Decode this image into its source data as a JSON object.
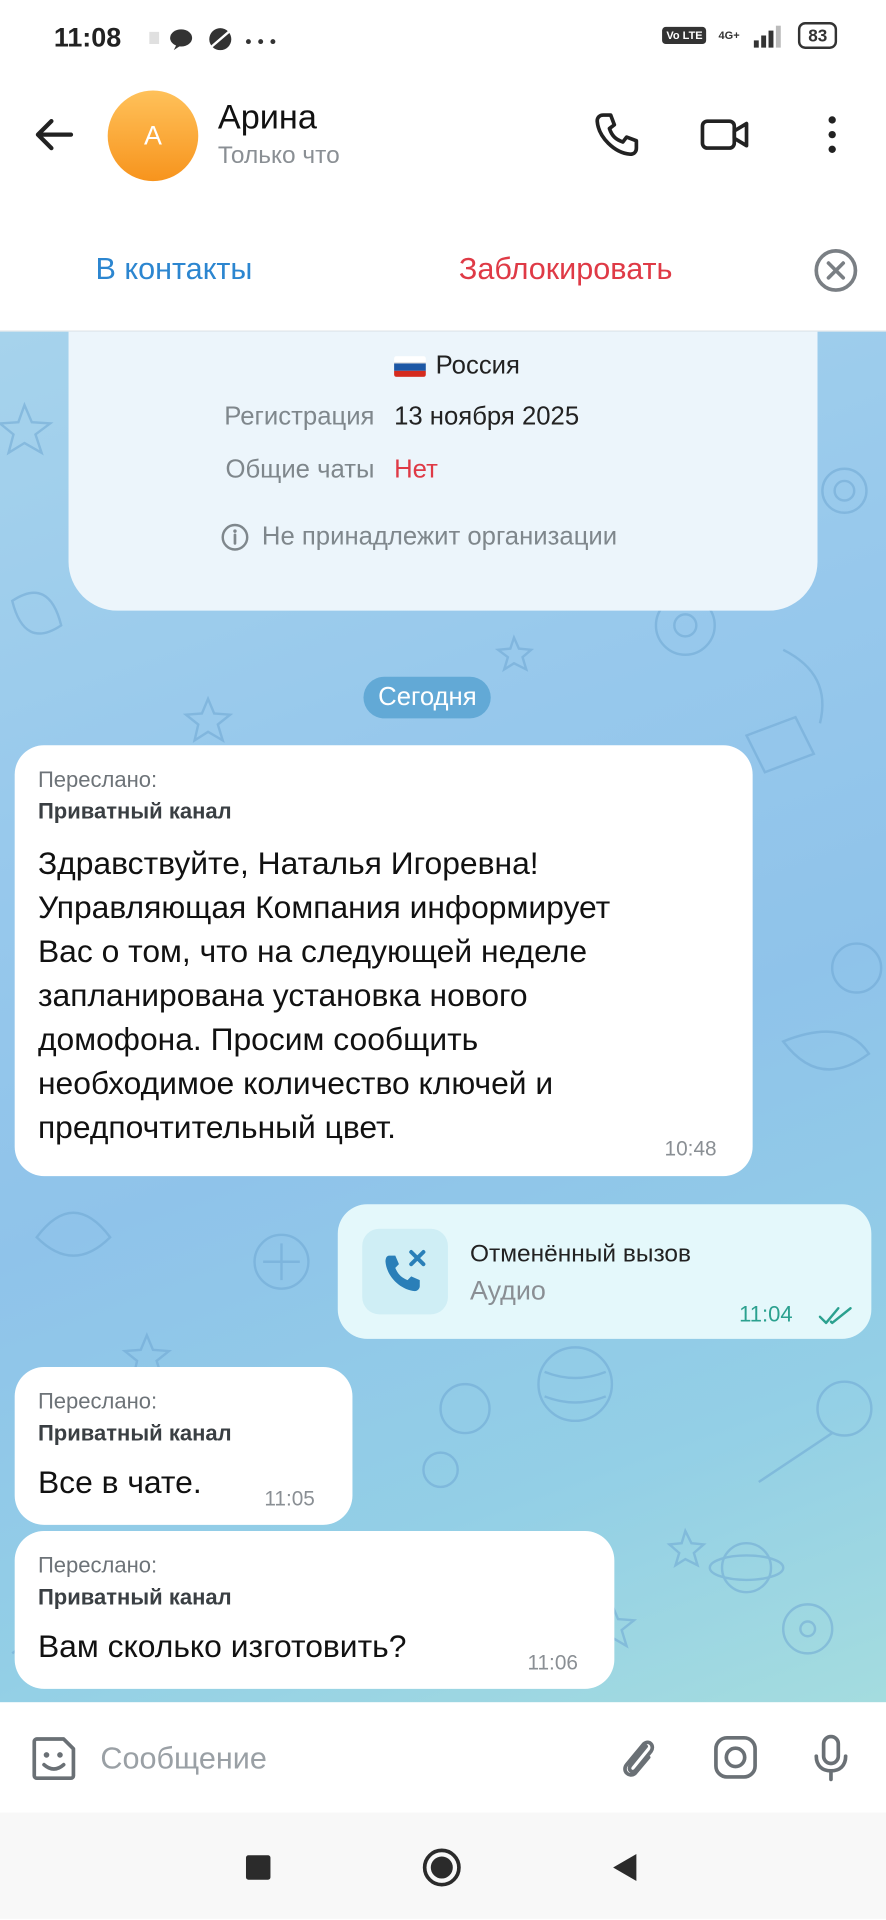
{
  "status_bar": {
    "time": "11:08",
    "volte": "Vo LTE",
    "network": "4G+",
    "battery": "83"
  },
  "header": {
    "avatar_letter": "A",
    "avatar_color": "#f7a233",
    "name": "Арина",
    "status": "Только что"
  },
  "actions": {
    "add_contact": "В контакты",
    "block": "Заблокировать"
  },
  "profile_info": {
    "country": "Россия",
    "registration_label": "Регистрация",
    "registration_value": "13 ноября 2025",
    "common_chats_label": "Общие чаты",
    "common_chats_value": "Нет",
    "organization_note": "Не принадлежит организации"
  },
  "date_separator": "Сегодня",
  "messages": [
    {
      "forwarded_label": "Переслано:",
      "forwarded_from": "Приватный канал",
      "lines": [
        "Здравствуйте, Наталья Игоревна!",
        "Управляющая Компания информирует",
        "Вас о том, что на следующей неделе",
        "запланирована установка нового",
        "домофона. Просим сообщить",
        "необходимое количество ключей и",
        "предпочтительный цвет."
      ],
      "time": "10:48"
    },
    {
      "call_title": "Отменённый вызов",
      "call_type": "Аудио",
      "time": "11:04"
    },
    {
      "forwarded_label": "Переслано:",
      "forwarded_from": "Приватный канал",
      "text": "Все в чате.",
      "time": "11:05"
    },
    {
      "forwarded_label": "Переслано:",
      "forwarded_from": "Приватный канал",
      "text": "Вам сколько изготовить?",
      "time": "11:06"
    }
  ],
  "input": {
    "placeholder": "Сообщение"
  },
  "colors": {
    "accent_blue": "#2c86d0",
    "danger_red": "#df3a46",
    "call_teal": "#2ba18f"
  }
}
